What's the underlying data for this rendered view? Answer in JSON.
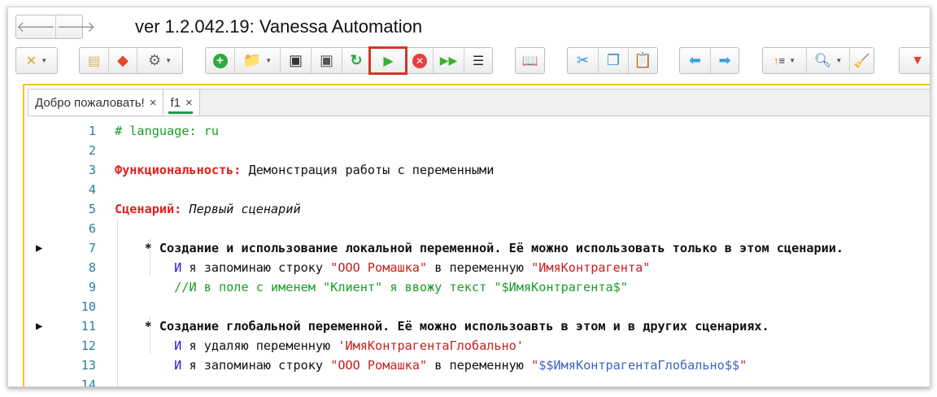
{
  "window": {
    "title": "ver 1.2.042.19: Vanessa Automation"
  },
  "nav": {
    "back": "back-arrow-icon",
    "forward": "forward-arrow-icon"
  },
  "toolbar": {
    "highlighted": "run-button",
    "highlight_color": "#d0382b"
  },
  "tabs": [
    {
      "label": "Добро пожаловать!",
      "close": "×"
    },
    {
      "label": "f1",
      "close": "×",
      "active": true
    }
  ],
  "lines": [
    {
      "n": "1",
      "seg": [
        [
          "cm",
          "# language: ru"
        ]
      ]
    },
    {
      "n": "2",
      "seg": []
    },
    {
      "n": "3",
      "seg": [
        [
          "kw",
          "Функциональность:"
        ],
        [
          "pl",
          " Демонстрация работы с переменными"
        ]
      ]
    },
    {
      "n": "4",
      "seg": []
    },
    {
      "n": "5",
      "seg": [
        [
          "kw",
          "Сценарий:"
        ],
        [
          "pl",
          " "
        ],
        [
          "it",
          "Первый сценарий"
        ]
      ]
    },
    {
      "n": "6",
      "seg": []
    },
    {
      "n": "7",
      "mark": true,
      "seg": [
        [
          "pl",
          "    "
        ],
        [
          "bold",
          "* Создание и использование локальной переменной. Её можно использовать только в этом сценарии."
        ]
      ]
    },
    {
      "n": "8",
      "seg": [
        [
          "pl",
          "        "
        ],
        [
          "and",
          "И"
        ],
        [
          "pl",
          " я запоминаю строку "
        ],
        [
          "str",
          "\"ООО Ромашка\""
        ],
        [
          "pl",
          " в переменную "
        ],
        [
          "str",
          "\"ИмяКонтрагента\""
        ]
      ]
    },
    {
      "n": "9",
      "seg": [
        [
          "pl",
          "        "
        ],
        [
          "cm",
          "//И в поле с именем \"Клиент\" я ввожу текст \"$ИмяКонтрагента$\""
        ]
      ]
    },
    {
      "n": "10",
      "seg": []
    },
    {
      "n": "11",
      "mark": true,
      "seg": [
        [
          "pl",
          "    "
        ],
        [
          "bold",
          "* Создание глобальной переменной. Её можно использоавть в этом и в других сценариях."
        ]
      ]
    },
    {
      "n": "12",
      "seg": [
        [
          "pl",
          "        "
        ],
        [
          "and",
          "И"
        ],
        [
          "pl",
          " я удаляю переменную "
        ],
        [
          "str",
          "'ИмяКонтрагентаГлобально'"
        ]
      ]
    },
    {
      "n": "13",
      "seg": [
        [
          "pl",
          "        "
        ],
        [
          "and",
          "И"
        ],
        [
          "pl",
          " я запоминаю строку "
        ],
        [
          "str",
          "\"ООО Ромашка\""
        ],
        [
          "pl",
          " в переменную "
        ],
        [
          "str",
          "\""
        ],
        [
          "var",
          "$$ИмяКонтрагентаГлобально$$"
        ],
        [
          "str",
          "\""
        ]
      ]
    },
    {
      "n": "14",
      "seg": []
    }
  ]
}
